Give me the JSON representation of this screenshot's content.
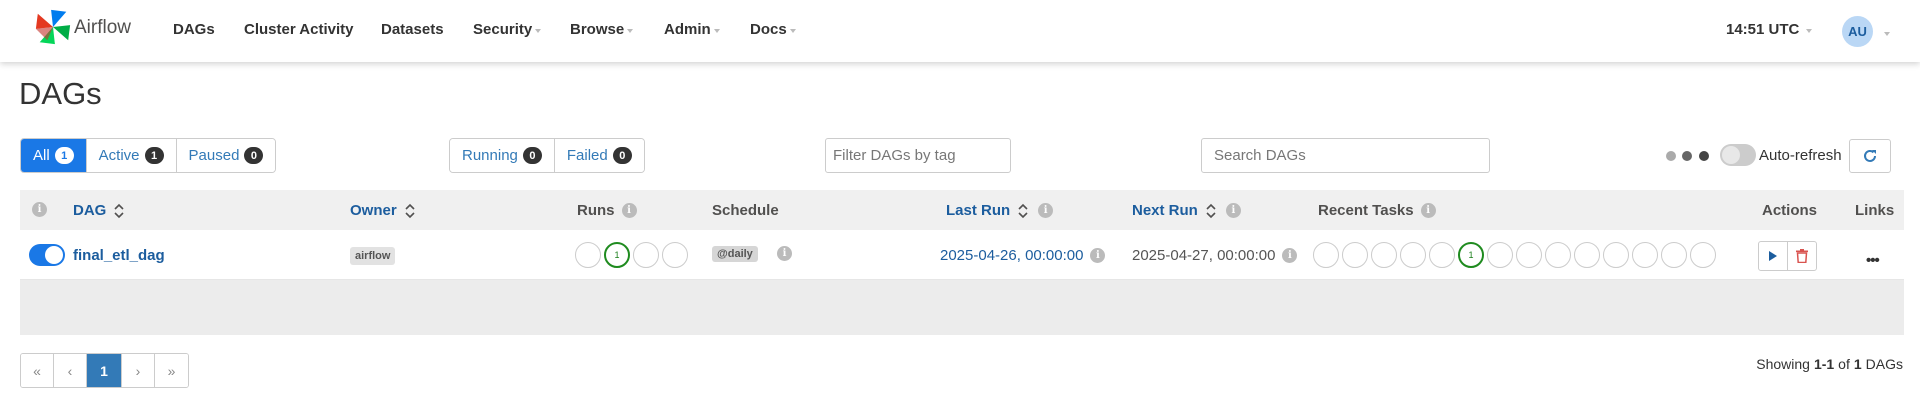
{
  "brand": {
    "name": "Airflow"
  },
  "nav": {
    "items": [
      {
        "label": "DAGs"
      },
      {
        "label": "Cluster Activity"
      },
      {
        "label": "Datasets"
      },
      {
        "label": "Security"
      },
      {
        "label": "Browse"
      },
      {
        "label": "Admin"
      },
      {
        "label": "Docs"
      }
    ],
    "time": "14:51 UTC",
    "user_initials": "AU"
  },
  "page": {
    "title": "DAGs"
  },
  "status_filter": {
    "all": {
      "label": "All",
      "count": "1"
    },
    "active": {
      "label": "Active",
      "count": "1"
    },
    "paused": {
      "label": "Paused",
      "count": "0"
    }
  },
  "run_filter": {
    "running": {
      "label": "Running",
      "count": "0"
    },
    "failed": {
      "label": "Failed",
      "count": "0"
    }
  },
  "tag_filter": {
    "placeholder": "Filter DAGs by tag"
  },
  "search": {
    "placeholder": "Search DAGs"
  },
  "auto_refresh": {
    "label": "Auto-refresh",
    "enabled": false
  },
  "table": {
    "headers": {
      "info": "i",
      "dag": "DAG",
      "owner": "Owner",
      "runs": "Runs",
      "schedule": "Schedule",
      "last_run": "Last Run",
      "next_run": "Next Run",
      "recent_tasks": "Recent Tasks",
      "actions": "Actions",
      "links": "Links"
    },
    "rows": [
      {
        "dag_id": "final_etl_dag",
        "active": true,
        "owner": "airflow",
        "runs_success": "1",
        "schedule": "@daily",
        "last_run": "2025-04-26, 00:00:00",
        "next_run": "2025-04-27, 00:00:00",
        "recent_tasks_success": "1",
        "more_label": "•••"
      }
    ]
  },
  "pagination": {
    "first": "«",
    "prev": "‹",
    "current": "1",
    "next": "›",
    "last": "»"
  },
  "showing": {
    "prefix": "Showing",
    "range": "1-1",
    "of": "of",
    "total": "1",
    "suffix": "DAGs"
  },
  "colors": {
    "primary": "#1a78e6",
    "link": "#1c5d9e",
    "success": "#1f8b1f",
    "danger": "#d9534f",
    "header_bg": "#f0f0f0"
  },
  "icons": {
    "logo": "airflow-pinwheel-icon",
    "refresh": "refresh-icon",
    "trigger": "play-icon",
    "delete": "trash-icon",
    "sort": "sort-icon",
    "info": "info-icon"
  }
}
